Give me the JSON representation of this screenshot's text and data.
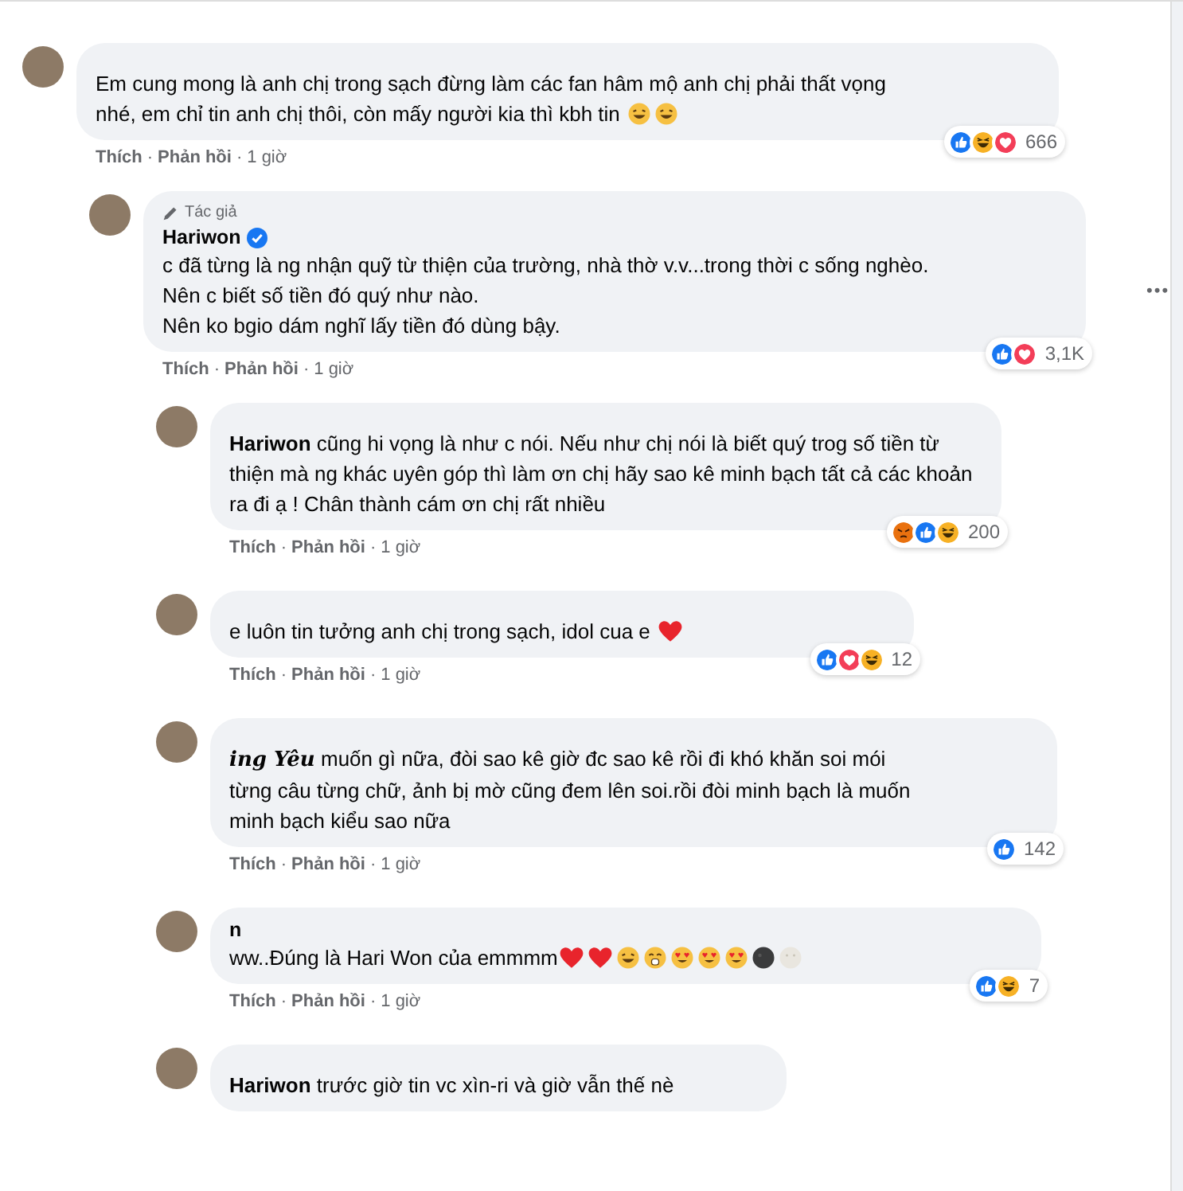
{
  "comments": [
    {
      "paragraphs": [
        [
          {
            "kind": "text",
            "text": "Em cung mong là anh chị trong sạch đừng làm các fan hâm mộ anh chị phải thất vọng nhé, em chỉ tin anh chị thôi, còn mấy người kia thì kbh tin "
          },
          {
            "kind": "grin"
          },
          {
            "kind": "grin"
          }
        ]
      ],
      "reactions": [
        {
          "kind": "like"
        },
        {
          "kind": "haha"
        },
        {
          "kind": "love"
        }
      ],
      "count": "666",
      "actions": {
        "like": "Thích",
        "reply": "Phản hồi",
        "time": "1 giờ",
        "separator": "·"
      },
      "replies": [
        {
          "badge": "Tác giả",
          "author": "Hariwon",
          "verified": true,
          "menu": "•••",
          "paragraphs": [
            [
              {
                "kind": "text",
                "text": "c đã từng là ng nhận quỹ từ thiện của trường, nhà thờ v.v...trong thời c sống nghèo."
              }
            ],
            [
              {
                "kind": "text",
                "text": "Nên c biết số tiền đó quý như nào."
              }
            ],
            [
              {
                "kind": "text",
                "text": "Nên ko bgio dám nghĩ lấy tiền đó dùng bậy."
              }
            ]
          ],
          "reactions": [
            {
              "kind": "like"
            },
            {
              "kind": "love"
            }
          ],
          "count": "3,1K",
          "actions": {
            "like": "Thích",
            "reply": "Phản hồi",
            "time": "1 giờ",
            "separator": "·"
          },
          "replies": [
            {
              "paragraphs": [
                [
                  {
                    "kind": "mention",
                    "text": "Hariwon"
                  },
                  {
                    "kind": "text",
                    "text": " cũng hi vọng là như c nói. Nếu như chị nói là biết quý trog số tiền từ thiện mà ng khác uyên góp thì làm ơn chị hãy sao kê minh bạch tất cả các khoản ra đi ạ ! Chân thành cám ơn chị rất nhiều"
                  }
                ]
              ],
              "reactions": [
                {
                  "kind": "angry"
                },
                {
                  "kind": "like"
                },
                {
                  "kind": "haha"
                }
              ],
              "count": "200",
              "actions": {
                "like": "Thích",
                "reply": "Phản hồi",
                "time": "1 giờ",
                "separator": "·"
              }
            },
            {
              "paragraphs": [
                [
                  {
                    "kind": "text",
                    "text": "e luôn tin tưởng anh chị trong sạch, idol cua e "
                  },
                  {
                    "kind": "heart"
                  }
                ]
              ],
              "reactions": [
                {
                  "kind": "like"
                },
                {
                  "kind": "love"
                },
                {
                  "kind": "haha"
                }
              ],
              "count": "12",
              "actions": {
                "like": "Thích",
                "reply": "Phản hồi",
                "time": "1 giờ",
                "separator": "·"
              }
            },
            {
              "paragraphs": [
                [
                  {
                    "kind": "tag",
                    "text": "ing Yêu"
                  },
                  {
                    "kind": "text",
                    "text": " muốn gì nữa, đòi sao kê giờ đc sao kê rồi đi khó khăn soi mói từng câu từng chữ, ảnh bị mờ cũng đem lên soi.rồi đòi minh bạch là muốn minh bạch kiểu sao nữa"
                  }
                ]
              ],
              "reactions": [
                {
                  "kind": "like"
                }
              ],
              "count": "142",
              "actions": {
                "like": "Thích",
                "reply": "Phản hồi",
                "time": "1 giờ",
                "separator": "·"
              }
            },
            {
              "author": "n",
              "paragraphs": [
                [
                  {
                    "kind": "text",
                    "text": "ww..Đúng là Hari Won của emmmm"
                  },
                  {
                    "kind": "heart"
                  },
                  {
                    "kind": "heart"
                  },
                  {
                    "kind": "grin"
                  },
                  {
                    "kind": "blush"
                  },
                  {
                    "kind": "hearteyes"
                  },
                  {
                    "kind": "hearteyes"
                  },
                  {
                    "kind": "hearteyes"
                  },
                  {
                    "kind": "dark"
                  },
                  {
                    "kind": "pale"
                  }
                ]
              ],
              "reactions": [
                {
                  "kind": "like"
                },
                {
                  "kind": "haha"
                }
              ],
              "count": "7",
              "actions": {
                "like": "Thích",
                "reply": "Phản hồi",
                "time": "1 giờ",
                "separator": "·"
              }
            },
            {
              "paragraphs": [
                [
                  {
                    "kind": "mention",
                    "text": "Hariwon"
                  },
                  {
                    "kind": "text",
                    "text": " trước giờ tin vc xìn-ri và giờ vẫn thế nè"
                  }
                ]
              ]
            }
          ]
        }
      ]
    }
  ]
}
